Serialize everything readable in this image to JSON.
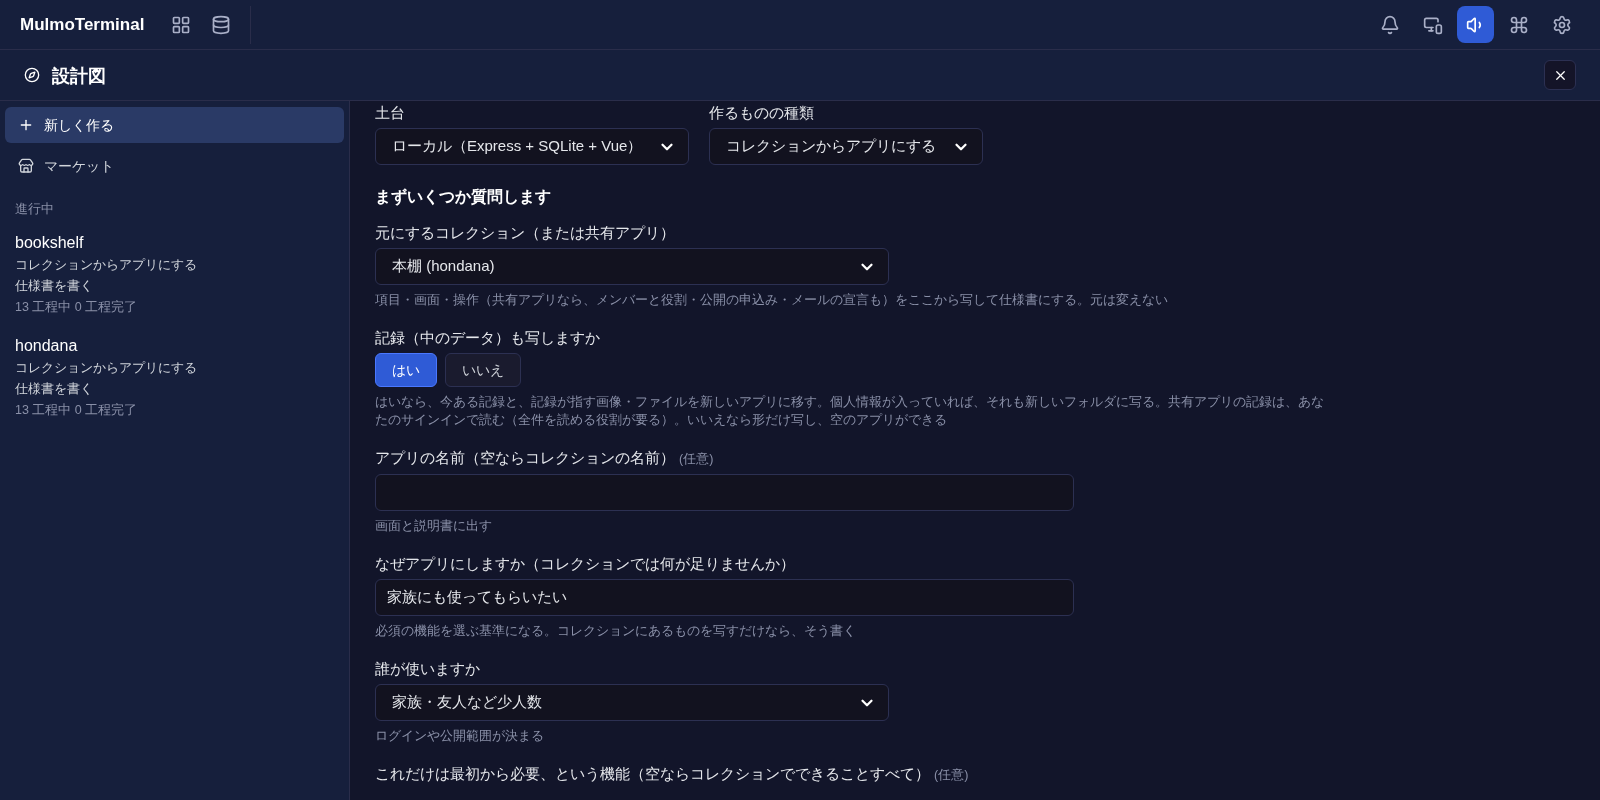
{
  "topbar": {
    "app_name": "MulmoTerminal",
    "nav_buttons": [
      {
        "kind": "grid"
      },
      {
        "kind": "database"
      }
    ],
    "tool_buttons": [
      {
        "kind": "bell",
        "selected": false
      },
      {
        "kind": "devices",
        "selected": false
      },
      {
        "kind": "speaker",
        "selected": true
      },
      {
        "kind": "command",
        "selected": false
      },
      {
        "kind": "settings",
        "selected": false
      }
    ]
  },
  "panel": {
    "title": "設計図"
  },
  "sidebar": {
    "items": [
      {
        "kind": "new",
        "label": "新しく作る",
        "selected": true
      },
      {
        "kind": "market",
        "label": "マーケット",
        "selected": false
      }
    ],
    "section": "進行中",
    "projects": [
      {
        "name": "bookshelf",
        "type": "コレクションからアプリにする",
        "step": "仕様書を書く",
        "progress": "13 工程中 0 工程完了"
      },
      {
        "name": "hondana",
        "type": "コレクションからアプリにする",
        "step": "仕様書を書く",
        "progress": "13 工程中 0 工程完了"
      }
    ]
  },
  "form": {
    "top_selects": [
      {
        "label": "土台",
        "value": "ローカル（Express + SQLite + Vue）"
      },
      {
        "label": "作るものの種類",
        "value": "コレクションからアプリにする"
      }
    ],
    "heading": "まずいくつか質問します",
    "fields": [
      {
        "kind": "select",
        "label": "元にするコレクション（または共有アプリ）",
        "value": "本棚 (hondana)",
        "hint": "項目・画面・操作（共有アプリなら、メンバーと役割・公開の申込み・メールの宣言も）をここから写して仕様書にする。元は変えない"
      },
      {
        "kind": "choice",
        "label": "記録（中のデータ）も写しますか",
        "options": [
          {
            "label": "はい",
            "selected": true
          },
          {
            "label": "いいえ",
            "selected": false
          }
        ],
        "hint": "はいなら、今ある記録と、記録が指す画像・ファイルを新しいアプリに移す。個人情報が入っていれば、それも新しいフォルダに写る。共有アプリの記録は、あなたのサインインで読む（全件を読める役割が要る）。いいえなら形だけ写し、空のアプリができる"
      },
      {
        "kind": "text",
        "label": "アプリの名前（空ならコレクションの名前）",
        "optional": "(任意)",
        "hint": "画面と説明書に出す"
      },
      {
        "kind": "text",
        "label": "なぜアプリにしますか（コレクションでは何が足りませんか）",
        "value": "家族にも使ってもらいたい",
        "hint": "必須の機能を選ぶ基準になる。コレクションにあるものを写すだけなら、そう書く"
      },
      {
        "kind": "select",
        "label": "誰が使いますか",
        "value": "家族・友人など少人数",
        "hint": "ログインや公開範囲が決まる"
      },
      {
        "kind": "label",
        "label": "これだけは最初から必要、という機能（空ならコレクションでできることすべて）",
        "optional": "(任意)"
      }
    ]
  }
}
